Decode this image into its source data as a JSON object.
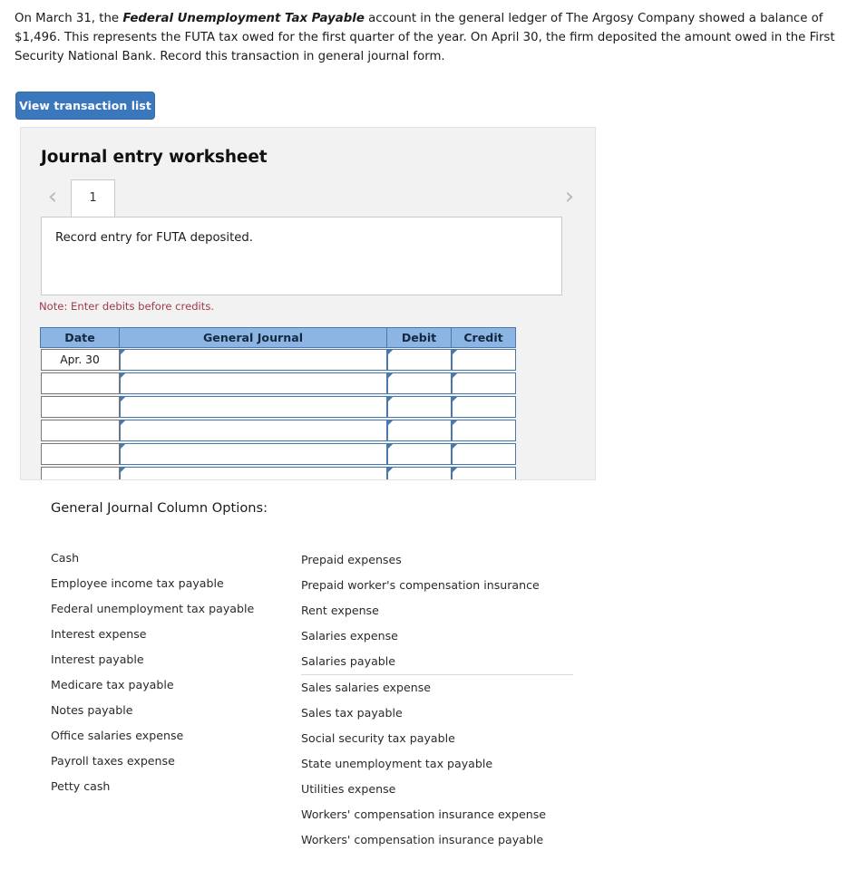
{
  "problem": {
    "part1": "On March 31, the ",
    "emphasis": "Federal Unemployment Tax Payable",
    "part2": " account in the general ledger of The Argosy Company showed a balance of $1,496. This represents the FUTA tax owed for the first quarter of the year. On April 30, the firm deposited the amount owed in the First Security National Bank. Record this transaction in general journal form."
  },
  "toolbar": {
    "view_transaction_list_label": "View transaction list"
  },
  "worksheet": {
    "title": "Journal entry worksheet",
    "prev_chevron": "‹",
    "next_chevron": "›",
    "tabs": [
      {
        "label": "1"
      }
    ],
    "prompt": "Record entry for FUTA deposited.",
    "note": "Note: Enter debits before credits."
  },
  "journal_table": {
    "headers": [
      "Date",
      "General Journal",
      "Debit",
      "Credit"
    ],
    "rows": [
      {
        "date": "Apr. 30",
        "general_journal": "",
        "debit": "",
        "credit": ""
      },
      {
        "date": "",
        "general_journal": "",
        "debit": "",
        "credit": ""
      },
      {
        "date": "",
        "general_journal": "",
        "debit": "",
        "credit": ""
      },
      {
        "date": "",
        "general_journal": "",
        "debit": "",
        "credit": ""
      },
      {
        "date": "",
        "general_journal": "",
        "debit": "",
        "credit": ""
      },
      {
        "date": "",
        "general_journal": "",
        "debit": "",
        "credit": ""
      }
    ]
  },
  "column_options": {
    "title": "General Journal Column Options:",
    "left": [
      "Cash",
      "Employee income tax payable",
      "Federal unemployment tax payable",
      "Interest expense",
      "Interest payable",
      "Medicare tax payable",
      "Notes payable",
      "Office salaries expense",
      "Payroll taxes expense",
      "Petty cash"
    ],
    "right": [
      "Prepaid expenses",
      "Prepaid worker's compensation insurance",
      "Rent expense",
      "Salaries expense",
      "Salaries payable",
      "Sales salaries expense",
      "Sales tax payable",
      "Social security tax payable",
      "State unemployment tax payable",
      "Utilities expense",
      "Workers' compensation insurance expense",
      "Workers' compensation insurance payable"
    ],
    "separator_after_index": 4
  },
  "colors": {
    "button_blue": "#3b77bd",
    "table_header_blue": "#8cb5e4",
    "cell_border_blue": "#4a78ab",
    "note_red": "#a13b46",
    "panel_gray": "#f2f2f2"
  }
}
